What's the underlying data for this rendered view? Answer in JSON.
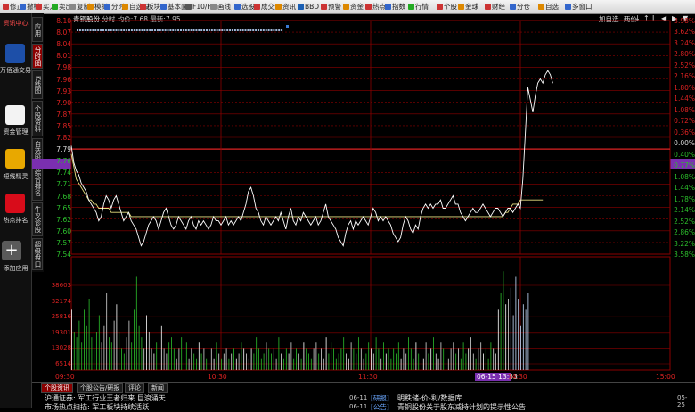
{
  "toolbar": {
    "items": [
      "修正",
      "撤權",
      "买入",
      "卖出",
      "复制",
      "模拟",
      "分时",
      "自选股",
      "板块",
      "基本面",
      "F10/F9",
      "画线",
      "选股",
      "成交量",
      "资讯",
      "BBD",
      "预警",
      "资金",
      "热点",
      "指数",
      "行情",
      "个股",
      "金球",
      "财经",
      "分仓",
      "自选",
      "多窗口"
    ]
  },
  "left_panel": {
    "top_label": "资讯中心",
    "items": [
      {
        "label": "万佰通交易",
        "icon": "phone-icon"
      },
      {
        "label": "资金管理",
        "icon": "money-icon"
      },
      {
        "label": "短线精灵",
        "icon": "gold-icon"
      },
      {
        "label": "热点排名",
        "icon": "bar-chart-icon"
      },
      {
        "label": "添加应用",
        "icon": "plus-icon"
      }
    ]
  },
  "vertical_tabs": [
    "应用",
    "分时图",
    "K线图",
    "个股资料",
    "自选股",
    "综合排名",
    "牛叉诊股",
    "超级盘口"
  ],
  "header": {
    "stock": "青铜股份",
    "mode": "分时",
    "avg_label": "均价:",
    "avg_value": "7.68",
    "last_label": "最新:",
    "last_value": "7.95",
    "right_links": [
      "加自选",
      "两价"
    ],
    "controls": [
      "↓",
      "↑",
      "Ⅰ",
      "◀",
      "▶",
      "▼"
    ]
  },
  "price_axis": {
    "prev_close": 7.79,
    "left": [
      "8.10",
      "8.07",
      "8.04",
      "8.01",
      "7.98",
      "7.96",
      "7.93",
      "7.90",
      "7.87",
      "7.85",
      "7.82",
      "7.79",
      "7.76",
      "7.74",
      "7.71",
      "7.68",
      "7.65",
      "7.62",
      "7.60",
      "7.57",
      "7.54"
    ],
    "right": [
      "3.98%",
      "3.62%",
      "3.24%",
      "2.80%",
      "2.52%",
      "2.16%",
      "1.80%",
      "1.44%",
      "1.08%",
      "0.72%",
      "0.36%",
      "0.00%",
      "0.40%",
      "0.77%",
      "1.08%",
      "1.44%",
      "1.78%",
      "2.14%",
      "2.52%",
      "2.86%",
      "3.22%",
      "3.58%"
    ]
  },
  "volume_axis": [
    "38603",
    "32174",
    "25816",
    "19301",
    "13028",
    "6514"
  ],
  "time_axis": {
    "labels": [
      "09:30",
      "10:30",
      "11:30",
      "14:30",
      "15:00"
    ],
    "cursor": "06-15 13:53"
  },
  "chart_data": {
    "type": "line",
    "title": "青铜股份 分时",
    "prev_close": 7.79,
    "price": [
      7.8,
      7.76,
      7.74,
      7.73,
      7.71,
      7.7,
      7.69,
      7.67,
      7.66,
      7.65,
      7.64,
      7.62,
      7.63,
      7.66,
      7.68,
      7.67,
      7.65,
      7.67,
      7.68,
      7.66,
      7.64,
      7.62,
      7.63,
      7.64,
      7.62,
      7.61,
      7.6,
      7.58,
      7.56,
      7.57,
      7.59,
      7.61,
      7.62,
      7.63,
      7.62,
      7.6,
      7.62,
      7.64,
      7.65,
      7.63,
      7.61,
      7.6,
      7.61,
      7.63,
      7.62,
      7.61,
      7.6,
      7.62,
      7.63,
      7.61,
      7.6,
      7.62,
      7.61,
      7.62,
      7.61,
      7.6,
      7.61,
      7.63,
      7.62,
      7.62,
      7.61,
      7.62,
      7.63,
      7.61,
      7.62,
      7.61,
      7.62,
      7.63,
      7.62,
      7.64,
      7.66,
      7.69,
      7.7,
      7.68,
      7.65,
      7.64,
      7.62,
      7.61,
      7.63,
      7.62,
      7.61,
      7.62,
      7.63,
      7.62,
      7.64,
      7.62,
      7.6,
      7.63,
      7.65,
      7.62,
      7.61,
      7.63,
      7.62,
      7.64,
      7.63,
      7.62,
      7.61,
      7.62,
      7.63,
      7.61,
      7.62,
      7.64,
      7.66,
      7.63,
      7.62,
      7.61,
      7.6,
      7.58,
      7.57,
      7.56,
      7.59,
      7.61,
      7.62,
      7.6,
      7.62,
      7.61,
      7.62,
      7.63,
      7.62,
      7.61,
      7.63,
      7.65,
      7.64,
      7.62,
      7.63,
      7.62,
      7.63,
      7.62,
      7.61,
      7.59,
      7.58,
      7.57,
      7.58,
      7.61,
      7.63,
      7.62,
      7.6,
      7.59,
      7.61,
      7.6,
      7.63,
      7.65,
      7.66,
      7.65,
      7.66,
      7.65,
      7.66,
      7.66,
      7.67,
      7.65,
      7.65,
      7.66,
      7.67,
      7.68,
      7.66,
      7.66,
      7.64,
      7.63,
      7.62,
      7.63,
      7.64,
      7.65,
      7.64,
      7.64,
      7.65,
      7.66,
      7.65,
      7.64,
      7.63,
      7.64,
      7.65,
      7.65,
      7.64,
      7.63,
      7.64,
      7.65,
      7.65,
      7.64,
      7.65,
      7.66,
      7.65,
      7.72,
      7.83,
      7.94,
      7.91,
      7.88,
      7.92,
      7.95,
      7.96,
      7.95,
      7.97,
      7.98,
      7.97,
      7.95
    ],
    "avg": [
      7.78,
      7.75,
      7.72,
      7.71,
      7.7,
      7.69,
      7.68,
      7.67,
      7.67,
      7.66,
      7.66,
      7.65,
      7.65,
      7.65,
      7.65,
      7.65,
      7.64,
      7.64,
      7.64,
      7.64,
      7.64,
      7.64,
      7.64,
      7.64,
      7.63,
      7.63,
      7.63,
      7.63,
      7.63,
      7.63,
      7.63,
      7.63,
      7.63,
      7.63,
      7.63,
      7.63,
      7.63,
      7.63,
      7.63,
      7.63,
      7.63,
      7.63,
      7.63,
      7.63,
      7.63,
      7.63,
      7.63,
      7.63,
      7.63,
      7.63,
      7.63,
      7.63,
      7.63,
      7.63,
      7.63,
      7.63,
      7.63,
      7.63,
      7.63,
      7.63,
      7.63,
      7.63,
      7.63,
      7.63,
      7.63,
      7.63,
      7.63,
      7.63,
      7.63,
      7.63,
      7.63,
      7.63,
      7.63,
      7.63,
      7.63,
      7.63,
      7.63,
      7.63,
      7.63,
      7.63,
      7.63,
      7.63,
      7.63,
      7.63,
      7.63,
      7.63,
      7.63,
      7.63,
      7.63,
      7.63,
      7.63,
      7.63,
      7.63,
      7.63,
      7.63,
      7.63,
      7.63,
      7.63,
      7.63,
      7.63,
      7.63,
      7.63,
      7.63,
      7.63,
      7.63,
      7.63,
      7.63,
      7.63,
      7.63,
      7.63,
      7.63,
      7.63,
      7.63,
      7.63,
      7.63,
      7.63,
      7.63,
      7.63,
      7.63,
      7.63,
      7.63,
      7.63,
      7.63,
      7.63,
      7.63,
      7.63,
      7.63,
      7.63,
      7.63,
      7.63,
      7.63,
      7.63,
      7.63,
      7.63,
      7.63,
      7.63,
      7.63,
      7.63,
      7.63,
      7.63,
      7.63,
      7.63,
      7.63,
      7.63,
      7.63,
      7.63,
      7.63,
      7.63,
      7.63,
      7.63,
      7.63,
      7.63,
      7.63,
      7.63,
      7.63,
      7.63,
      7.63,
      7.63,
      7.63,
      7.63,
      7.63,
      7.63,
      7.63,
      7.63,
      7.63,
      7.63,
      7.63,
      7.63,
      7.63,
      7.63,
      7.63,
      7.63,
      7.63,
      7.63,
      7.64,
      7.64,
      7.65,
      7.66,
      7.66,
      7.66,
      7.67,
      7.67,
      7.67,
      7.67,
      7.67,
      7.67,
      7.67,
      7.67,
      7.67,
      7.67
    ],
    "volume_levels": [
      0.55,
      0.35,
      0.3,
      0.45,
      0.25,
      0.55,
      0.4,
      0.65,
      0.3,
      0.2,
      0.35,
      0.5,
      0.25,
      0.4,
      0.7,
      0.3,
      0.25,
      0.45,
      0.6,
      0.35,
      0.2,
      0.15,
      0.3,
      0.45,
      0.25,
      0.55,
      0.85,
      0.4,
      0.3,
      0.2,
      0.5,
      0.35,
      0.2,
      0.15,
      0.25,
      0.3,
      0.4,
      0.2,
      0.15,
      0.25,
      0.3,
      0.2,
      0.1,
      0.2,
      0.3,
      0.15,
      0.25,
      0.1,
      0.2,
      0.15,
      0.1,
      0.25,
      0.15,
      0.2,
      0.1,
      0.15,
      0.2,
      0.1,
      0.25,
      0.15,
      0.1,
      0.15,
      0.2,
      0.1,
      0.15,
      0.2,
      0.1,
      0.15,
      0.25,
      0.2,
      0.15,
      0.1,
      0.2,
      0.15,
      0.3,
      0.2,
      0.1,
      0.15,
      0.25,
      0.2,
      0.15,
      0.2,
      0.1,
      0.3,
      0.15,
      0.1,
      0.2,
      0.15,
      0.25,
      0.1,
      0.2,
      0.15,
      0.1,
      0.25,
      0.2,
      0.15,
      0.1,
      0.2,
      0.25,
      0.15,
      0.2,
      0.1,
      0.3,
      0.15,
      0.25,
      0.2,
      0.1,
      0.15,
      0.2,
      0.3,
      0.15,
      0.1,
      0.25,
      0.2,
      0.15,
      0.3,
      0.2,
      0.1,
      0.15,
      0.25,
      0.2,
      0.15,
      0.3,
      0.2,
      0.1,
      0.25,
      0.15,
      0.2,
      0.1,
      0.2,
      0.15,
      0.25,
      0.1,
      0.2,
      0.15,
      0.3,
      0.2,
      0.1,
      0.25,
      0.15,
      0.2,
      0.1,
      0.25,
      0.15,
      0.2,
      0.3,
      0.15,
      0.1,
      0.25,
      0.2,
      0.15,
      0.1,
      0.2,
      0.25,
      0.15,
      0.2,
      0.1,
      0.25,
      0.15,
      0.2,
      0.3,
      0.15,
      0.1,
      0.2,
      0.25,
      0.15,
      0.2,
      0.1,
      0.25,
      0.2,
      0.15,
      0.55,
      0.7,
      0.9,
      0.6,
      0.65,
      0.75,
      0.5,
      0.85,
      0.65,
      0.4,
      0.6,
      0.55,
      0.7
    ],
    "ylim": [
      7.54,
      8.1
    ],
    "xlabel": "",
    "ylabel": ""
  },
  "news": {
    "tabs": [
      "个股资讯",
      "个股公告/研报",
      "评论",
      "新闻"
    ],
    "rows": [
      {
        "text": "沪通证券: 军工行业王者归来 巨浪涌天",
        "date": "06-11",
        "tag": "[研报]",
        "right": "明秩储-价-利/数据库"
      },
      {
        "text": "市场热点扫描: 军工板块持续活跃",
        "date": "06-11",
        "tag": "[公告]",
        "right": "青铜股份关于股东减持计划的提示性公告"
      }
    ],
    "right_date": "05-25"
  },
  "colors": {
    "up": "#d22020",
    "down": "#2cbf2c",
    "price_line": "#ffffff",
    "avg_line": "#e8e080",
    "grid": "#8b0000"
  }
}
